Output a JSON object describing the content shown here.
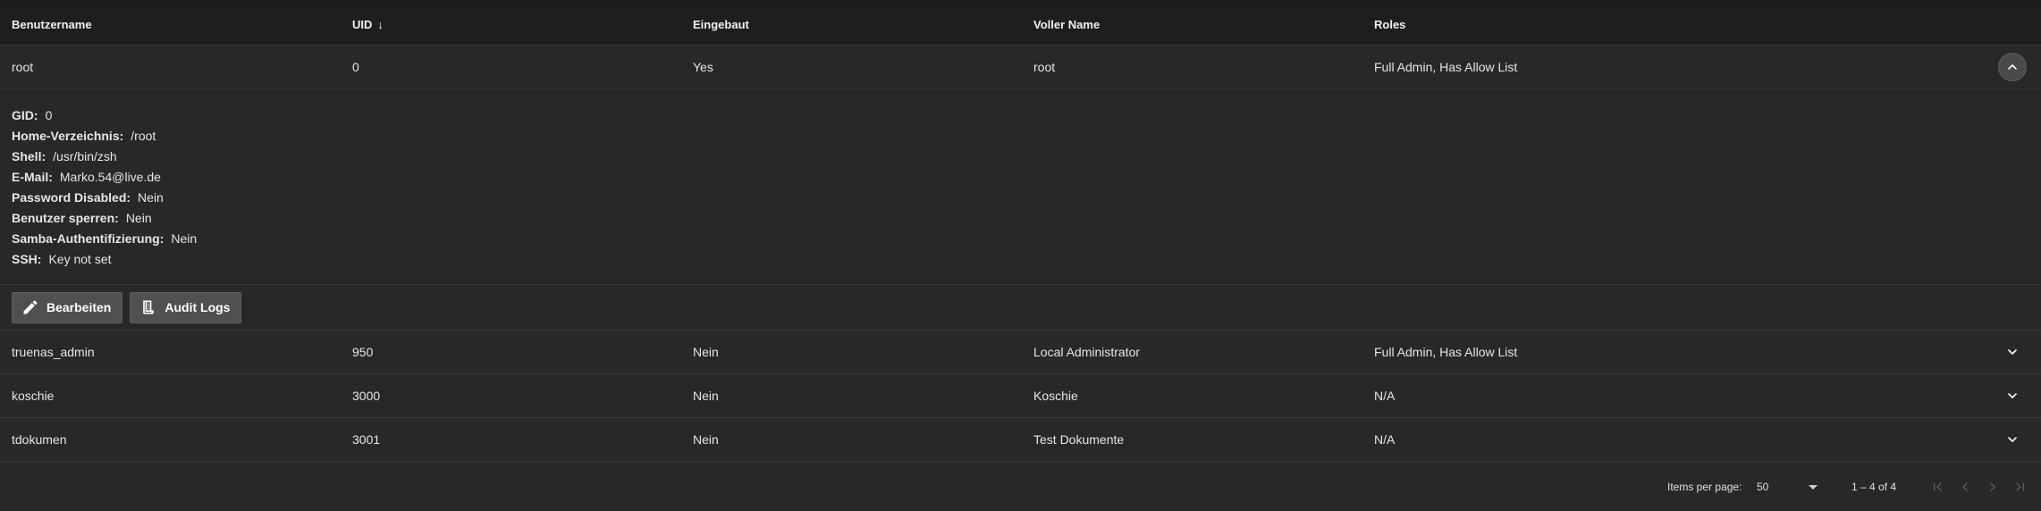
{
  "table": {
    "columns": [
      {
        "label": "Benutzername"
      },
      {
        "label": "UID"
      },
      {
        "label": "Eingebaut"
      },
      {
        "label": "Voller Name"
      },
      {
        "label": "Roles"
      }
    ],
    "sort_indicator": "↓",
    "rows": [
      {
        "username": "root",
        "uid": "0",
        "builtin": "Yes",
        "full_name": "root",
        "roles": "Full Admin, Has Allow List",
        "expanded": true
      },
      {
        "username": "truenas_admin",
        "uid": "950",
        "builtin": "Nein",
        "full_name": "Local Administrator",
        "roles": "Full Admin, Has Allow List",
        "expanded": false
      },
      {
        "username": "koschie",
        "uid": "3000",
        "builtin": "Nein",
        "full_name": "Koschie",
        "roles": "N/A",
        "expanded": false
      },
      {
        "username": "tdokumen",
        "uid": "3001",
        "builtin": "Nein",
        "full_name": "Test Dokumente",
        "roles": "N/A",
        "expanded": false
      }
    ]
  },
  "details": {
    "gid": {
      "label": "GID:",
      "value": "0"
    },
    "home": {
      "label": "Home-Verzeichnis:",
      "value": "/root"
    },
    "shell": {
      "label": "Shell:",
      "value": "/usr/bin/zsh"
    },
    "email": {
      "label": "E-Mail:",
      "value": "Marko.54@live.de"
    },
    "password_disabled": {
      "label": "Password Disabled:",
      "value": "Nein"
    },
    "lock_user": {
      "label": "Benutzer sperren:",
      "value": "Nein"
    },
    "samba_auth": {
      "label": "Samba-Authentifizierung:",
      "value": "Nein"
    },
    "ssh": {
      "label": "SSH:",
      "value": "Key not set"
    }
  },
  "actions": {
    "edit_label": "Bearbeiten",
    "audit_label": "Audit Logs"
  },
  "paginator": {
    "items_per_page_label": "Items per page:",
    "items_per_page_value": "50",
    "range_label": "1 – 4 of 4"
  },
  "icons": {
    "edit": "pencil-icon",
    "audit": "receipt-icon",
    "expand": "chevron-down-icon",
    "collapse": "chevron-up-icon"
  }
}
